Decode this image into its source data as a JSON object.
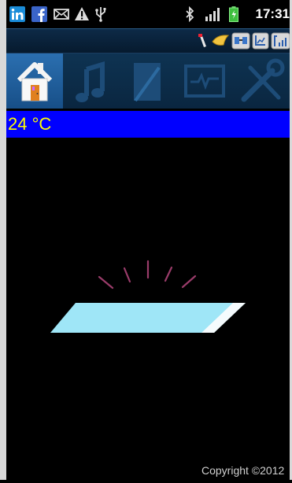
{
  "status_bar": {
    "time": "17:31",
    "icons": [
      "linkedin-icon",
      "facebook-icon",
      "mail-icon",
      "warning-icon",
      "usb-icon",
      "bluetooth-icon",
      "signal-icon",
      "battery-icon"
    ]
  },
  "app_header": {
    "icons": [
      "cleaning-icon",
      "settings-icon",
      "network-icon",
      "signal-tool-icon"
    ]
  },
  "tabs": [
    {
      "icon": "house-icon",
      "active": true
    },
    {
      "icon": "music-note-icon",
      "active": false
    },
    {
      "icon": "notepad-icon",
      "active": false
    },
    {
      "icon": "monitor-pulse-icon",
      "active": false
    },
    {
      "icon": "wrench-screwdriver-icon",
      "active": false
    }
  ],
  "temperature": {
    "value": "24 °C",
    "bar_color": "#0000ff",
    "text_color": "#ffff00"
  },
  "illustration": {
    "name": "glowing-light-panel",
    "panel_color": "#9fe6f7",
    "ray_color": "#9a3c6a"
  },
  "footer": {
    "copyright": "Copyright ©2012"
  }
}
